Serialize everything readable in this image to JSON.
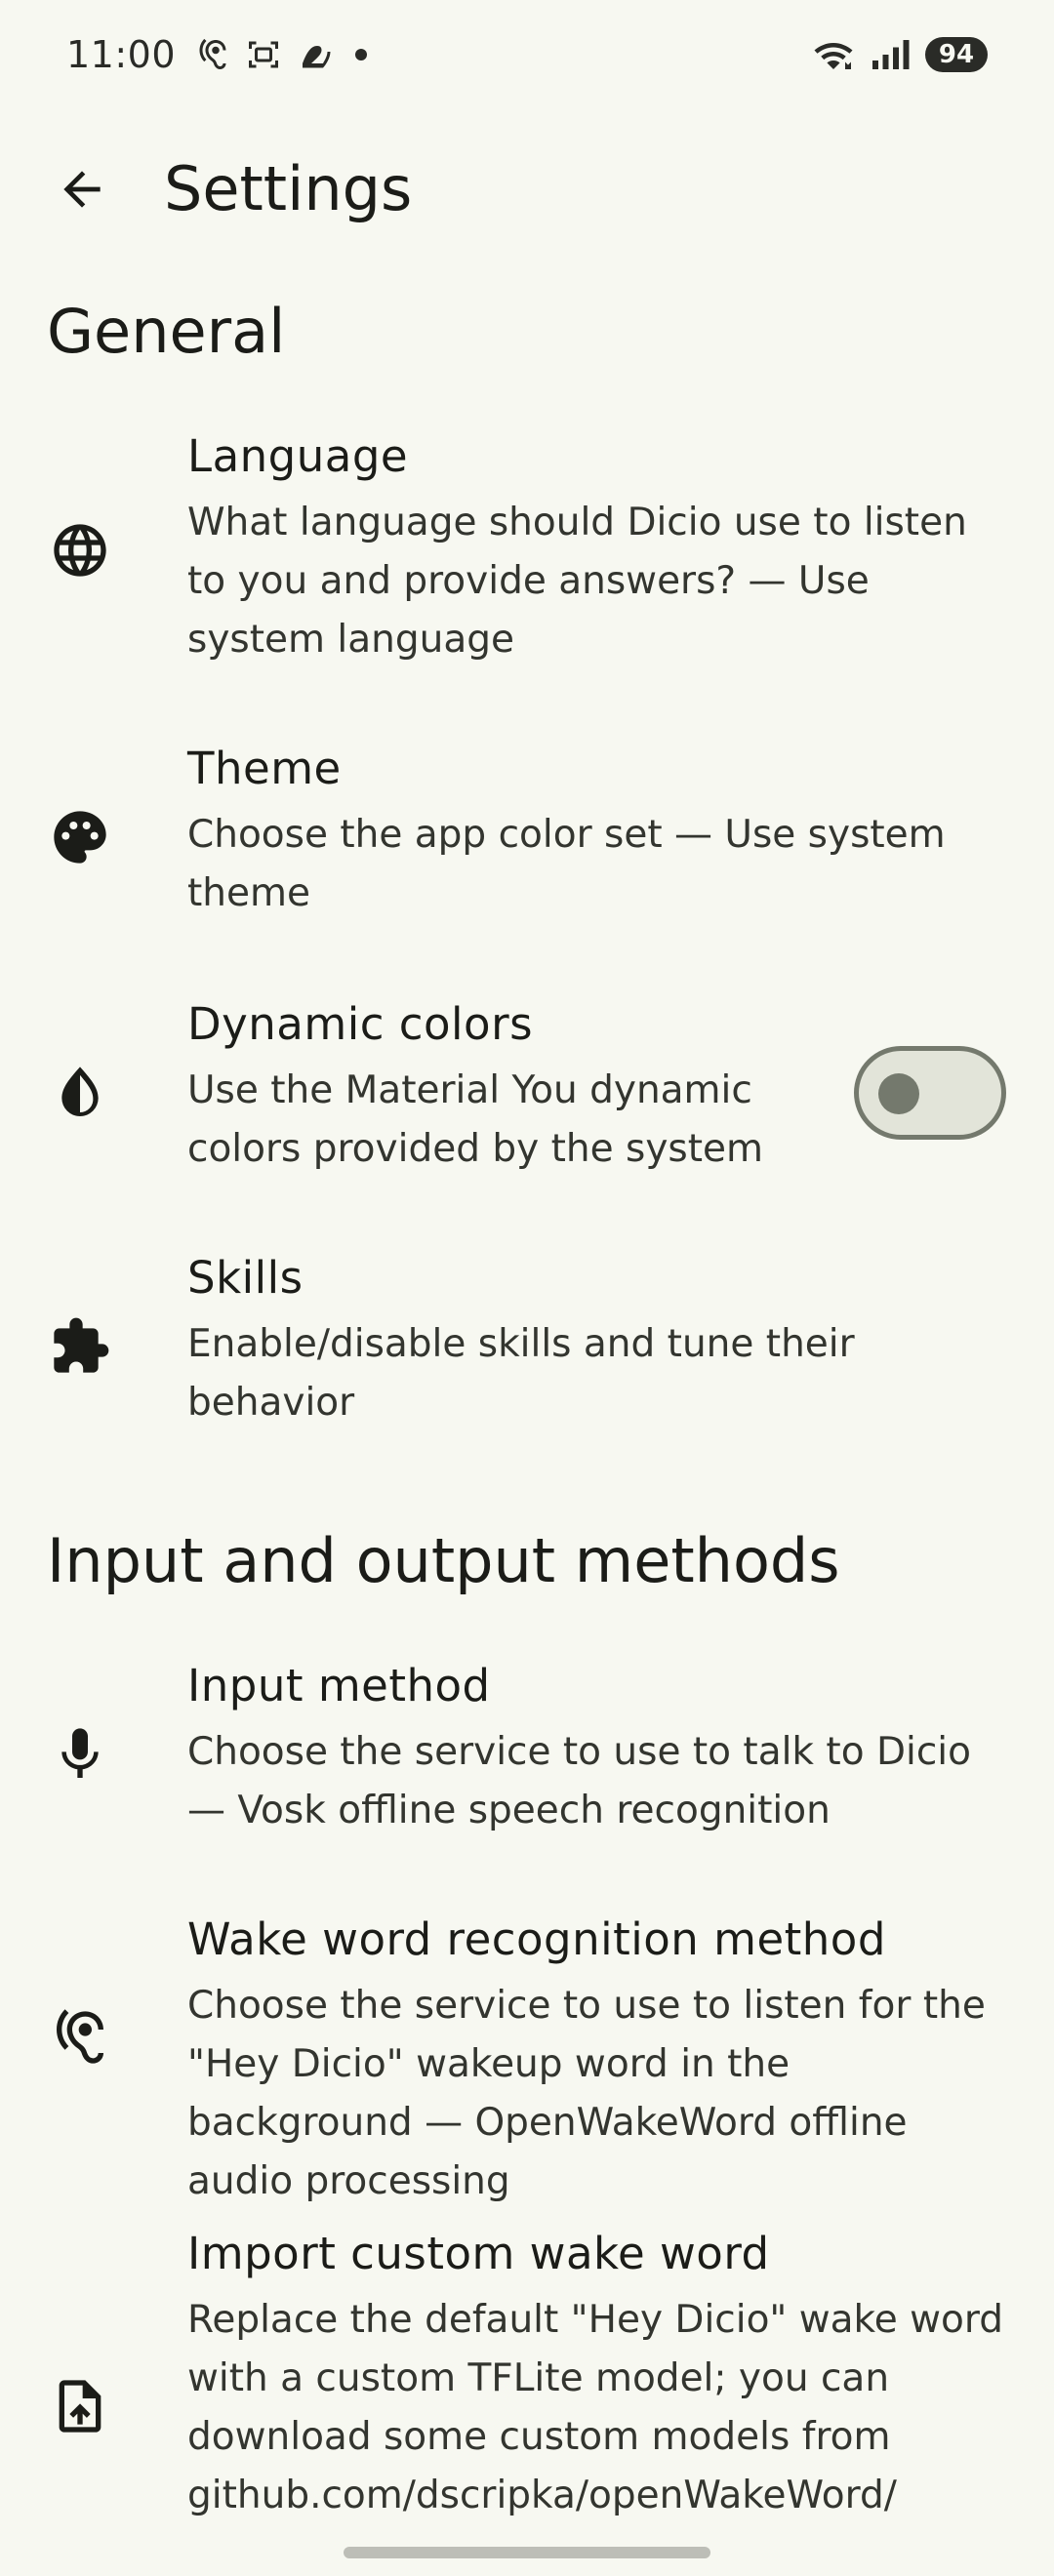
{
  "status_bar": {
    "time": "11:00",
    "battery": "94",
    "icons_left": [
      "hearing-icon",
      "screenshot-icon",
      "app-icon",
      "notification-dot"
    ],
    "icons_right": [
      "wifi-icon",
      "signal-icon",
      "battery-icon"
    ]
  },
  "top_bar": {
    "title": "Settings",
    "back_icon": "arrow-back-icon"
  },
  "sections": {
    "general": {
      "header": "General",
      "items": [
        {
          "icon": "globe-icon",
          "title": "Language",
          "summary": "What language should Dicio use to listen to you and provide answers? — Use system language"
        },
        {
          "icon": "palette-icon",
          "title": "Theme",
          "summary": "Choose the app color set — Use system theme"
        },
        {
          "icon": "contrast-icon",
          "title": "Dynamic colors",
          "summary": "Use the Material You dynamic colors provided by the system",
          "switch_on": false
        },
        {
          "icon": "puzzle-icon",
          "title": "Skills",
          "summary": "Enable/disable skills and tune their behavior"
        }
      ]
    },
    "io": {
      "header": "Input and output methods",
      "items": [
        {
          "icon": "microphone-icon",
          "title": "Input method",
          "summary": "Choose the service to use to talk to Dicio — Vosk offline speech recognition"
        },
        {
          "icon": "hearing-icon",
          "title": "Wake word recognition method",
          "summary": "Choose the service to use to listen for the \"Hey Dicio\" wakeup word in the background — OpenWakeWord offline audio processing"
        },
        {
          "icon": "file-upload-icon",
          "title": "Import custom wake word",
          "summary": "Replace the default \"Hey Dicio\" wake word with a custom TFLite model; you can download some custom models from github.com/dscripka/openWakeWord/"
        }
      ]
    }
  },
  "colors": {
    "background": "#f7f8f1",
    "on_surface": "#1b1c18",
    "switch_track": "#e2e4d9",
    "switch_outline": "#74796d"
  }
}
